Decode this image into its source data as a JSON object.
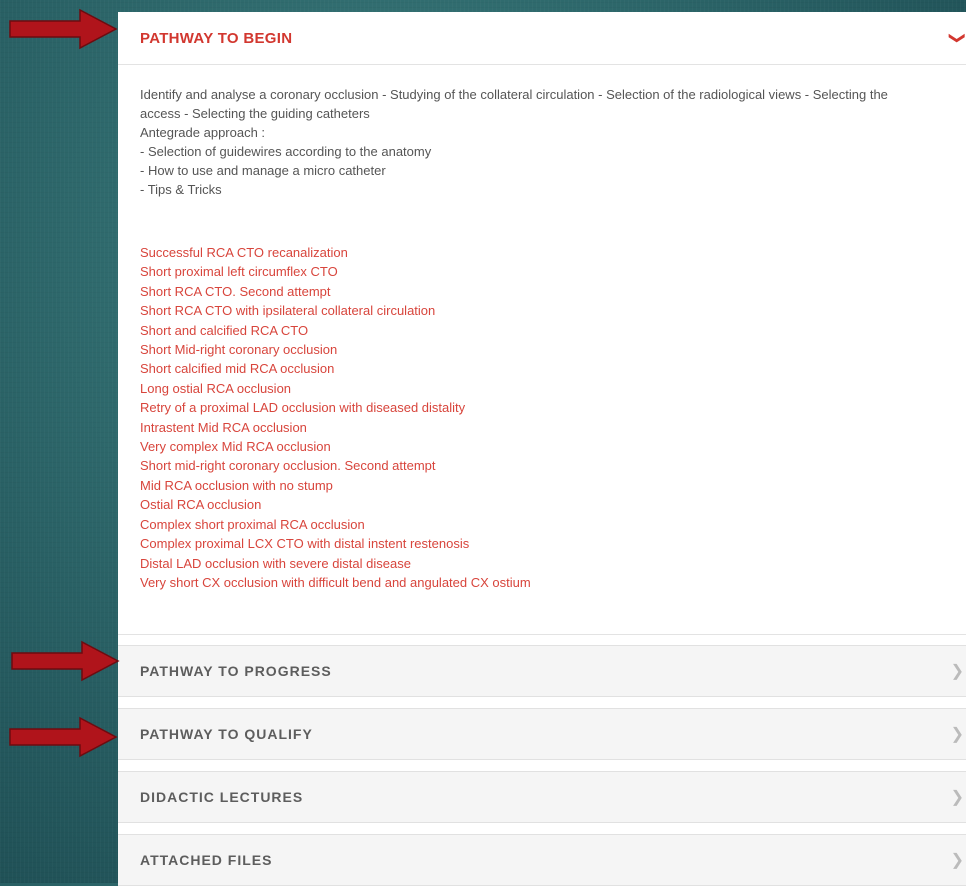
{
  "sections": {
    "open": {
      "title": "PATHWAY TO BEGIN",
      "description_lines": [
        "Identify and analyse a coronary occlusion - Studying of the collateral circulation - Selection of the radiological views - Selecting the",
        "access - Selecting the guiding catheters",
        "Antegrade approach :",
        "- Selection of guidewires according to the anatomy",
        "- How to use and manage a micro catheter",
        "- Tips & Tricks"
      ],
      "links": [
        "Successful RCA CTO recanalization",
        "Short proximal left circumflex CTO",
        "Short RCA CTO. Second attempt",
        "Short RCA CTO with ipsilateral collateral circulation",
        "Short and calcified RCA CTO",
        "Short Mid-right coronary occlusion",
        "Short calcified mid RCA occlusion",
        "Long ostial RCA occlusion",
        "Retry of a proximal LAD occlusion with diseased distality",
        "Intrastent Mid RCA occlusion",
        "Very complex Mid RCA occlusion",
        "Short mid-right coronary occlusion. Second attempt",
        "Mid RCA occlusion with no stump",
        "Ostial RCA occlusion",
        "Complex short proximal RCA occlusion",
        "Complex proximal LCX CTO with distal instent restenosis",
        "Distal LAD occlusion with severe distal disease",
        "Very short CX occlusion with difficult bend and angulated CX ostium"
      ]
    },
    "collapsed": [
      {
        "title": "PATHWAY TO PROGRESS"
      },
      {
        "title": "PATHWAY TO QUALIFY"
      },
      {
        "title": "DIDACTIC LECTURES"
      },
      {
        "title": "ATTACHED FILES"
      }
    ]
  },
  "icons": {
    "expanded": "chevron-down-icon",
    "collapsed": "chevron-right-icon",
    "annotation": "red-arrow-icon"
  },
  "colors": {
    "accent_red": "#d2372f",
    "link_red": "#d8453c",
    "collapsed_title": "#5d5d5d",
    "background": "#2f6a6d"
  }
}
